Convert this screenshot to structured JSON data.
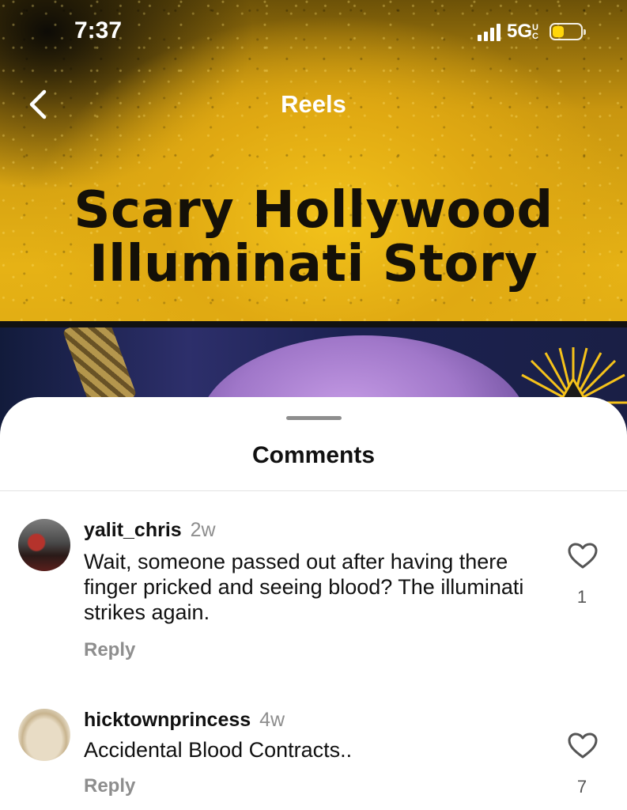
{
  "status_bar": {
    "time": "7:37",
    "network": "5G",
    "network_sub": "UC",
    "battery_color": "#ffd60a"
  },
  "nav": {
    "back_icon": "chevron-left-icon",
    "title": "Reels"
  },
  "reel": {
    "title_line1": "Scary Hollywood",
    "title_line2": "Illuminati Story"
  },
  "comments_sheet": {
    "title": "Comments",
    "comments": [
      {
        "username": "yalit_chris",
        "age": "2w",
        "text": "Wait, someone passed out after having there finger pricked and seeing blood? The illuminati strikes again.",
        "reply_label": "Reply",
        "likes": "1",
        "like_icon": "heart-outline-icon"
      },
      {
        "username": "hicktownprincess",
        "age": "4w",
        "text": "Accidental Blood Contracts..",
        "reply_label": "Reply",
        "likes": "7",
        "like_icon": "heart-outline-icon"
      }
    ]
  }
}
